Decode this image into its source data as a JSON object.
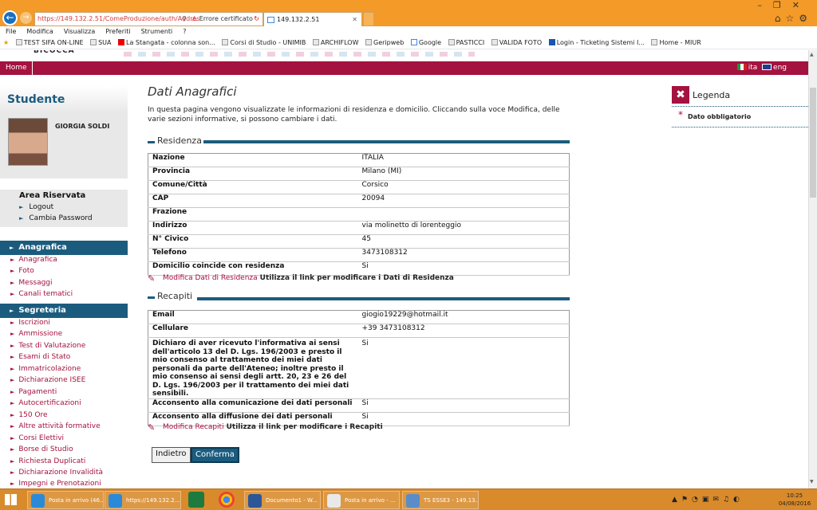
{
  "browser": {
    "address": "https://149.132.2.51/ComeProduzione/auth/Addres",
    "cert_error": "Errore certificato",
    "tab_title": "149.132.2.51",
    "menu": [
      "File",
      "Modifica",
      "Visualizza",
      "Preferiti",
      "Strumenti",
      "?"
    ],
    "favorites": [
      "TEST SIFA ON-LINE",
      "SUA",
      "La Stangata - colonna son...",
      "Corsi di Studio - UNIMIB",
      "ARCHIFLOW",
      "Geripweb",
      "Google",
      "PASTICCI",
      "VALIDA FOTO",
      "Login - Ticketing Sistemi I...",
      "Home - MIUR"
    ]
  },
  "header": {
    "home": "Home",
    "lang_it": "ita",
    "lang_en": "eng"
  },
  "sidebar": {
    "title": "Studente",
    "student_name": "GIORGIA SOLDI",
    "area_title": "Area Riservata",
    "area_links": [
      "Logout",
      "Cambia Password"
    ],
    "sections": [
      {
        "title": "Anagrafica",
        "links": [
          "Anagrafica",
          "Foto",
          "Messaggi",
          "Canali tematici"
        ]
      },
      {
        "title": "Segreteria",
        "links": [
          "Iscrizioni",
          "Ammissione",
          "Test di Valutazione",
          "Esami di Stato",
          "Immatricolazione",
          "Dichiarazione ISEE",
          "Pagamenti",
          "Autocertificazioni",
          "150 Ore",
          "Altre attività formative",
          "Corsi Elettivi",
          "Borse di Studio",
          "Richiesta Duplicati",
          "Dichiarazione Invalidità",
          "Impegni e Prenotazioni"
        ]
      }
    ]
  },
  "main": {
    "heading": "Dati Anagrafici",
    "intro": "In questa pagina vengono visualizzate le informazioni di residenza e domicilio. Cliccando sulla voce Modifica, delle varie sezioni informative, si possono cambiare i dati.",
    "residenza": {
      "title": "Residenza",
      "rows": [
        {
          "k": "Nazione",
          "v": "ITALIA"
        },
        {
          "k": "Provincia",
          "v": "Milano (MI)"
        },
        {
          "k": "Comune/Città",
          "v": "Corsico"
        },
        {
          "k": "CAP",
          "v": "20094"
        },
        {
          "k": "Frazione",
          "v": ""
        },
        {
          "k": "Indirizzo",
          "v": "via molinetto di lorenteggio"
        },
        {
          "k": "N° Civico",
          "v": "45"
        },
        {
          "k": "Telefono",
          "v": "3473108312"
        },
        {
          "k": "Domicilio coincide con residenza",
          "v": "Si"
        }
      ],
      "edit_link": "Modifica Dati di Residenza",
      "edit_hint": "Utilizza il link per modificare i Dati di Residenza"
    },
    "recapiti": {
      "title": "Recapiti",
      "rows": [
        {
          "k": "Email",
          "v": "giogio19229@hotmail.it"
        },
        {
          "k": "Cellulare",
          "v": "+39 3473108312"
        },
        {
          "k": "Dichiaro di aver ricevuto l'informativa ai sensi dell'articolo 13 del D. Lgs. 196/2003 e presto il mio consenso al trattamento dei miei dati personali da parte dell'Ateneo; inoltre presto il mio consenso ai sensi degli artt. 20, 23 e 26 del D. Lgs. 196/2003 per il trattamento dei miei dati sensibili.",
          "v": "Si"
        },
        {
          "k": "Acconsento alla comunicazione dei dati personali",
          "v": "Si"
        },
        {
          "k": "Acconsento alla diffusione dei dati personali",
          "v": "Si"
        }
      ],
      "edit_link": "Modifica Recapiti",
      "edit_hint": "Utilizza il link per modificare i Recapiti"
    },
    "btn_back": "Indietro",
    "btn_confirm": "Conferma"
  },
  "legend": {
    "title": "Legenda",
    "item": "Dato obbligatorio"
  },
  "taskbar": {
    "items": [
      "Posta in arrivo (46...",
      "https://149.132.2....",
      "Documento1 - W...",
      "Posta in arrivo - ...",
      "TS ESSE3 - 149.13..."
    ],
    "time": "10:25",
    "date": "04/08/2016"
  }
}
